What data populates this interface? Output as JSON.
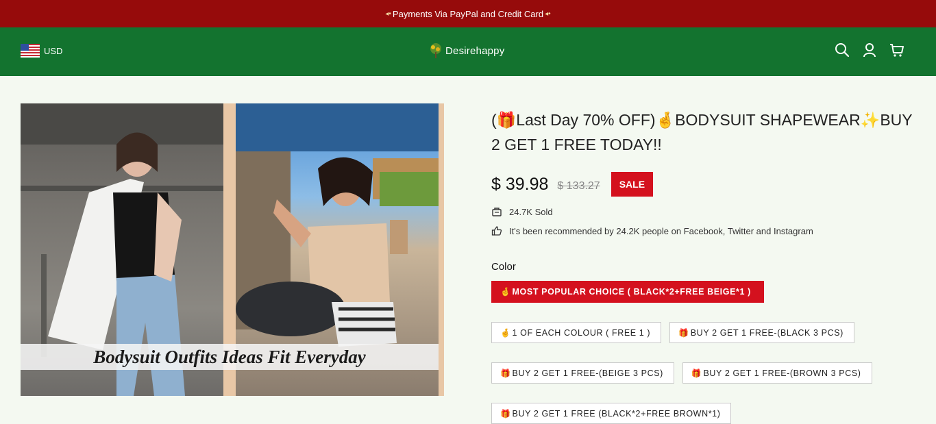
{
  "announcement": {
    "text": "Payments Via PayPal and Credit Card",
    "ornament": "◂•"
  },
  "header": {
    "currency": "USD",
    "logo_text": "Desirehappy",
    "icons": [
      "search-icon",
      "account-icon",
      "cart-icon"
    ]
  },
  "gallery": {
    "caption": "Bodysuit Outfits Ideas Fit Everyday"
  },
  "product": {
    "title": "(🎁Last Day 70% OFF)🤞BODYSUIT SHAPEWEAR✨BUY 2 GET 1 FREE TODAY!!",
    "price": "$ 39.98",
    "compare_price": "$ 133.27",
    "sale_badge": "SALE",
    "sold": "24.7K Sold",
    "recommended": "It's been recommended by 24.2K people on Facebook, Twitter and Instagram",
    "color_label": "Color",
    "variants": [
      {
        "icon": "🤞",
        "label": "MOST POPULAR CHOICE ( BLACK*2+FREE BEIGE*1 )",
        "selected": true
      },
      {
        "icon": "🤞",
        "label": "1 OF EACH COLOUR ( FREE 1 )",
        "selected": false
      },
      {
        "icon": "🎁",
        "label": "BUY 2 GET 1 FREE-(BLACK 3 PCS)",
        "selected": false
      },
      {
        "icon": "🎁",
        "label": "BUY 2 GET 1 FREE-(BEIGE 3 PCS)",
        "selected": false
      },
      {
        "icon": "🎁",
        "label": "BUY 2 GET 1 FREE-(BROWN 3 PCS)",
        "selected": false
      },
      {
        "icon": "🎁",
        "label": "BUY 2 GET 1 FREE (BLACK*2+FREE BROWN*1)",
        "selected": false
      }
    ]
  },
  "colors": {
    "announcement_bg": "#960b0b",
    "header_bg": "#13732f",
    "sale_red": "#d4111e",
    "page_bg": "#f4f9f1"
  }
}
